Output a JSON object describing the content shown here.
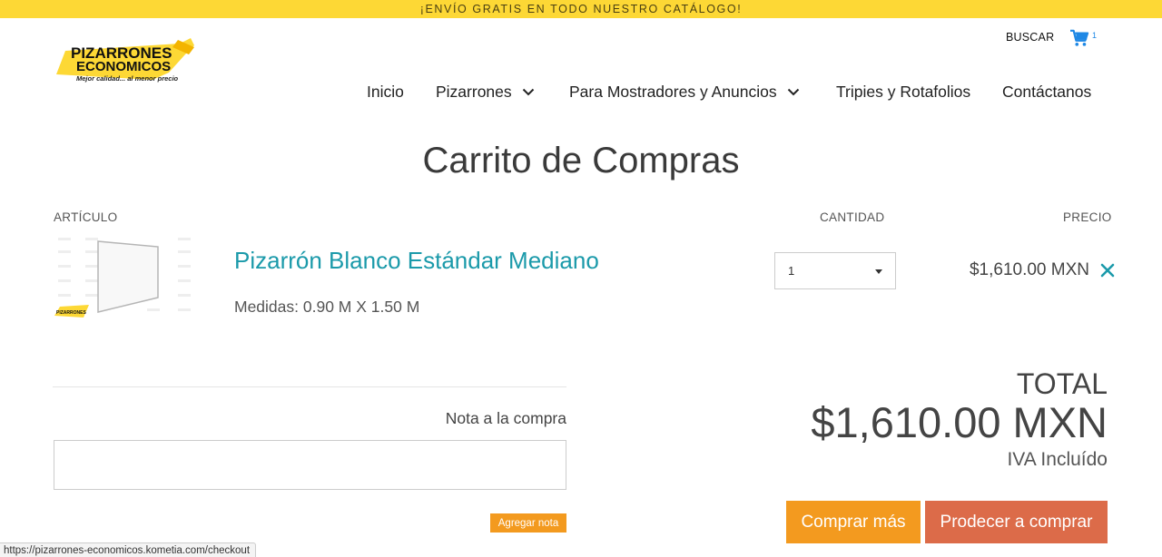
{
  "promo_bar": {
    "text": "¡ENVÍO GRATIS EN TODO NUESTRO CATÁLOGO!"
  },
  "logo": {
    "line1": "PIZARRONES",
    "line2": "ECONOMICOS",
    "tagline": "Mejor calidad... al menor precio",
    "brand_color": "#fdd835"
  },
  "header": {
    "search_label": "BUSCAR",
    "cart_count": "1",
    "cart_icon_color": "#1e88e5"
  },
  "nav": {
    "items": [
      {
        "label": "Inicio"
      },
      {
        "label": "Pizarrones"
      },
      {
        "label": "Para Mostradores y Anuncios"
      },
      {
        "label": "Tripies y Rotafolios"
      },
      {
        "label": "Contáctanos"
      }
    ]
  },
  "cart": {
    "title": "Carrito de Compras",
    "columns": {
      "item": "ARTÍCULO",
      "quantity": "CANTIDAD",
      "price": "PRECIO"
    },
    "items": [
      {
        "name": "Pizarrón Blanco Estándar Mediano",
        "meta": "Medidas: 0.90 M X 1.50 M",
        "quantity": "1",
        "price": "$1,610.00 MXN"
      }
    ],
    "note": {
      "label": "Nota a la compra",
      "placeholder": "",
      "button": "Agregar nota"
    },
    "summary": {
      "total_label": "TOTAL",
      "total_amount": "$1,610.00 MXN",
      "tax_note": "IVA Incluído"
    },
    "actions": {
      "continue_shopping": "Comprar más",
      "checkout": "Prodecer a comprar"
    }
  },
  "status_bar": {
    "url": "https://pizarrones-economicos.kometia.com/checkout"
  },
  "colors": {
    "accent_teal": "#1b9aaa",
    "button_orange": "#f39a1f",
    "button_coral": "#dc6b49",
    "promo_yellow": "#fdd835"
  }
}
